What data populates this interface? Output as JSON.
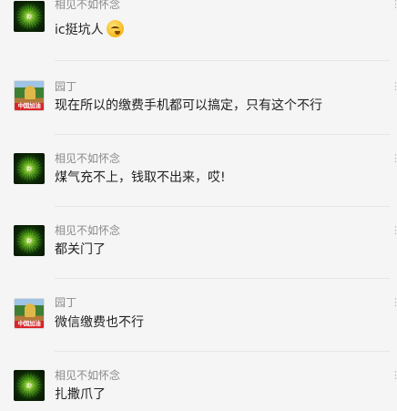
{
  "comments": [
    {
      "nickname": "相见不如怀念",
      "text": "ic挺坑人",
      "emoji": "thinking-face-emoji",
      "avatar": "green-leaf-avatar"
    },
    {
      "nickname": "园丁",
      "text": "现在所以的缴费手机都可以搞定，只有这个不行",
      "avatar": "gardener-photo-avatar",
      "avatar_caption": "中国加油"
    },
    {
      "nickname": "相见不如怀念",
      "text": "煤气充不上，钱取不出来，哎!",
      "avatar": "green-leaf-avatar"
    },
    {
      "nickname": "相见不如怀念",
      "text": "都关门了",
      "avatar": "green-leaf-avatar"
    },
    {
      "nickname": "园丁",
      "text": "微信缴费也不行",
      "avatar": "gardener-photo-avatar",
      "avatar_caption": "中国加油"
    },
    {
      "nickname": "相见不如怀念",
      "text": "扎撒爪了",
      "avatar": "green-leaf-avatar"
    }
  ],
  "side_icon": "reply-icon",
  "colors": {
    "background": "#f5f5f5",
    "nickname": "#8a8a8a",
    "text": "#222222",
    "divider": "#e6e6e6"
  }
}
